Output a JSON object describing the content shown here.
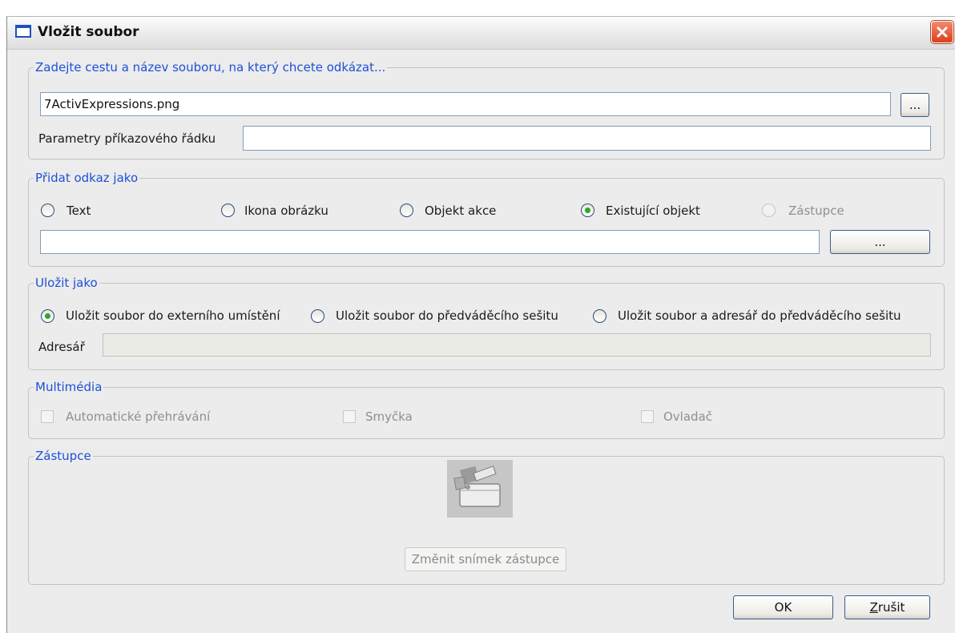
{
  "window": {
    "title": "Vložit soubor"
  },
  "file_group": {
    "legend": "Zadejte cestu a název souboru, na který chcete odkázat...",
    "path_value": "7ActivExpressions.png",
    "browse_label": "...",
    "params_label": "Parametry příkazového řádku",
    "params_value": ""
  },
  "link_group": {
    "legend": "Přidat odkaz jako",
    "options": [
      {
        "label": "Text",
        "checked": false,
        "disabled": false
      },
      {
        "label": "Ikona obrázku",
        "checked": false,
        "disabled": false
      },
      {
        "label": "Objekt akce",
        "checked": false,
        "disabled": false
      },
      {
        "label": "Existující objekt",
        "checked": true,
        "disabled": false
      },
      {
        "label": "Zástupce",
        "checked": false,
        "disabled": true
      }
    ],
    "object_value": "",
    "browse_label": "..."
  },
  "save_group": {
    "legend": "Uložit jako",
    "options": [
      {
        "label": "Uložit soubor do externího umístění",
        "checked": true
      },
      {
        "label": "Uložit soubor do předváděcího sešitu",
        "checked": false
      },
      {
        "label": "Uložit soubor a adresář do předváděcího sešitu",
        "checked": false
      }
    ],
    "dir_label": "Adresář",
    "dir_value": ""
  },
  "multimedia_group": {
    "legend": "Multimédia",
    "options": [
      {
        "label": "Automatické přehrávání",
        "checked": false
      },
      {
        "label": "Smyčka",
        "checked": false
      },
      {
        "label": "Ovladač",
        "checked": false
      }
    ]
  },
  "placeholder_group": {
    "legend": "Zástupce",
    "change_label": "Změnit snímek zástupce"
  },
  "buttons": {
    "ok": "OK",
    "cancel_hotkey": "Z",
    "cancel_rest": "rušit"
  },
  "colors": {
    "legend": "#1e50d8",
    "radio_dot": "#2ea52e",
    "close": "#d9401c"
  }
}
